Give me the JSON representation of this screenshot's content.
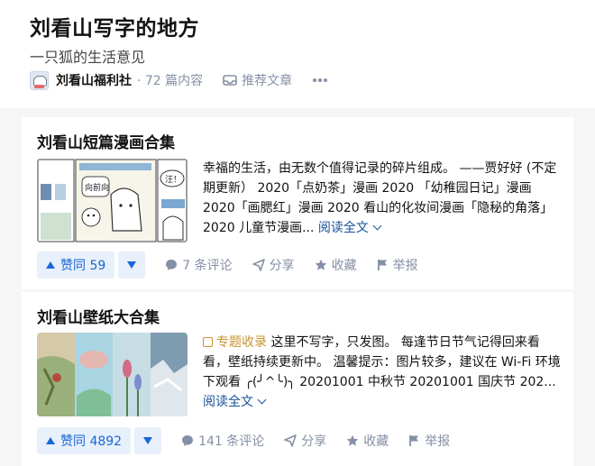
{
  "column": {
    "title": "刘看山写字的地方",
    "subtitle": "一只狐的生活意见",
    "author": "刘看山福利社",
    "article_count": "· 72 篇内容",
    "recommend_label": "推荐文章",
    "more_label": "···"
  },
  "articles": [
    {
      "title": "刘看山短篇漫画合集",
      "excerpt": "幸福的生活，由无数个值得记录的碎片组成。 ——贾好好 (不定期更新） 2020「点奶茶」漫画 2020 「幼稚园日记」漫画 2020「画腮红」漫画 2020 看山的化妆间漫画「隐秘的角落」 2020 儿童节漫画...",
      "read_more": "阅读全文",
      "votes": "赞同 59",
      "comments": "7 条评论",
      "share": "分享",
      "favorite": "收藏",
      "report": "举报",
      "thumb_text": "向前向",
      "thumb_bubble": "汪！"
    },
    {
      "title": "刘看山壁纸大合集",
      "tag": "专题收录",
      "excerpt": "这里不写字，只发图。 每逢节日节气记得回来看看，壁纸持续更新中。 温馨提示：图片较多，建议在 Wi-Fi 环境下观看 ╭(╯^╰)╮ 20201001 中秋节 20201001 国庆节 202...",
      "read_more": "阅读全文",
      "votes": "赞同 4892",
      "comments": "141 条评论",
      "share": "分享",
      "favorite": "收藏",
      "report": "举报"
    }
  ],
  "colors": {
    "accent": "#1a66d6",
    "vote_bg": "#e8f0fb",
    "meta_gray": "#8590a6",
    "link": "#175199",
    "tag": "#c7932e"
  }
}
